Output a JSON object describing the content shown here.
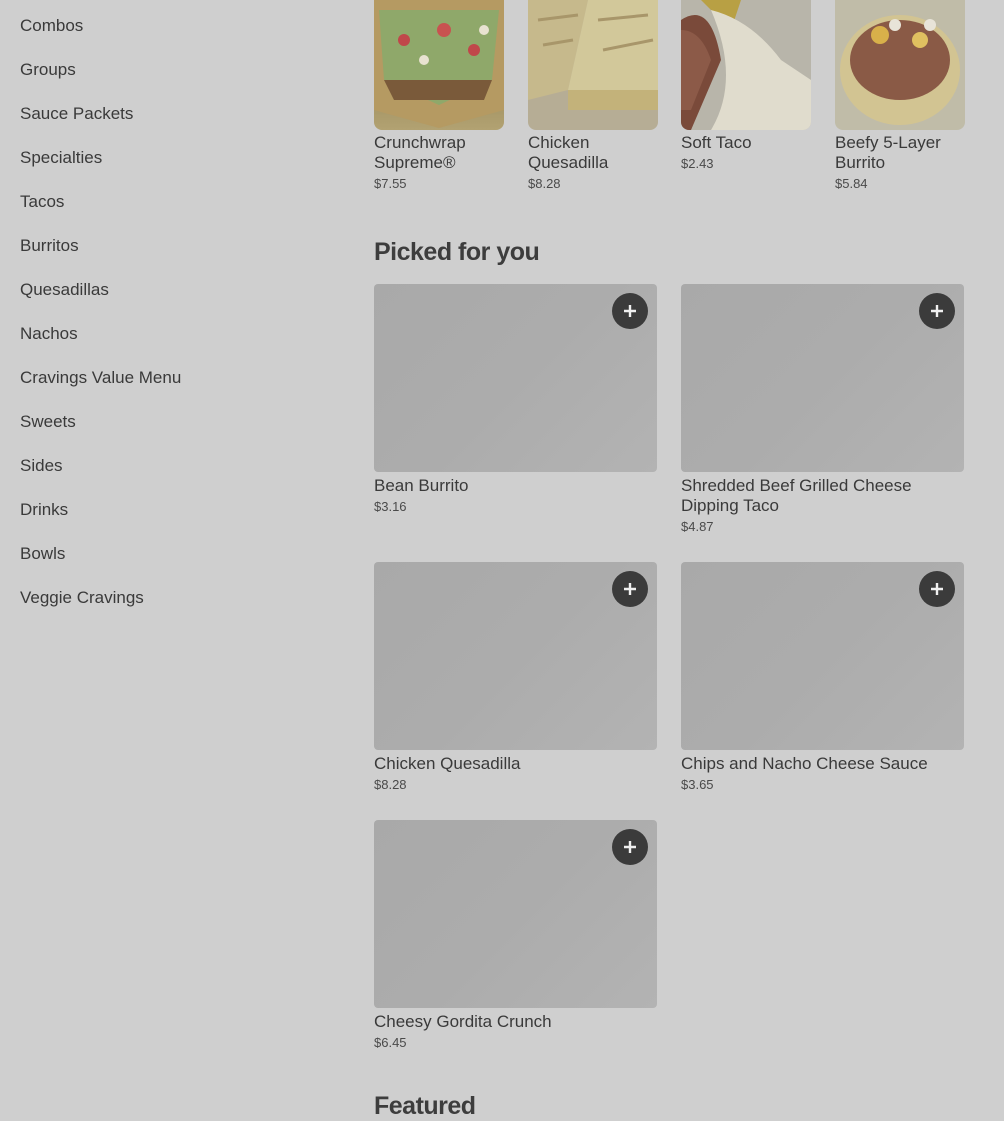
{
  "sidebar": {
    "items": [
      {
        "label": "Combos"
      },
      {
        "label": "Groups"
      },
      {
        "label": "Sauce Packets"
      },
      {
        "label": "Specialties"
      },
      {
        "label": "Tacos"
      },
      {
        "label": "Burritos"
      },
      {
        "label": "Quesadillas"
      },
      {
        "label": "Nachos"
      },
      {
        "label": "Cravings Value Menu"
      },
      {
        "label": "Sweets"
      },
      {
        "label": "Sides"
      },
      {
        "label": "Drinks"
      },
      {
        "label": "Bowls"
      },
      {
        "label": "Veggie Cravings"
      }
    ]
  },
  "top_items": [
    {
      "name": "Crunchwrap Supreme®",
      "price": "$7.55"
    },
    {
      "name": "Chicken Quesadilla",
      "price": "$8.28"
    },
    {
      "name": "Soft Taco",
      "price": "$2.43"
    },
    {
      "name": "Beefy 5-Layer Burrito",
      "price": "$5.84"
    }
  ],
  "picked": {
    "title": "Picked for you",
    "items": [
      {
        "name": "Bean Burrito",
        "price": "$3.16"
      },
      {
        "name": "Shredded Beef Grilled Cheese Dipping Taco",
        "price": "$4.87"
      },
      {
        "name": "Chicken Quesadilla",
        "price": "$8.28"
      },
      {
        "name": "Chips and Nacho Cheese Sauce",
        "price": "$3.65"
      },
      {
        "name": "Cheesy Gordita Crunch",
        "price": "$6.45"
      }
    ]
  },
  "featured": {
    "title": "Featured"
  },
  "colors": {
    "overlay_bg": "#cfcfcf",
    "add_button": "#3b3b3b"
  },
  "icons": {
    "add": "plus-icon"
  }
}
